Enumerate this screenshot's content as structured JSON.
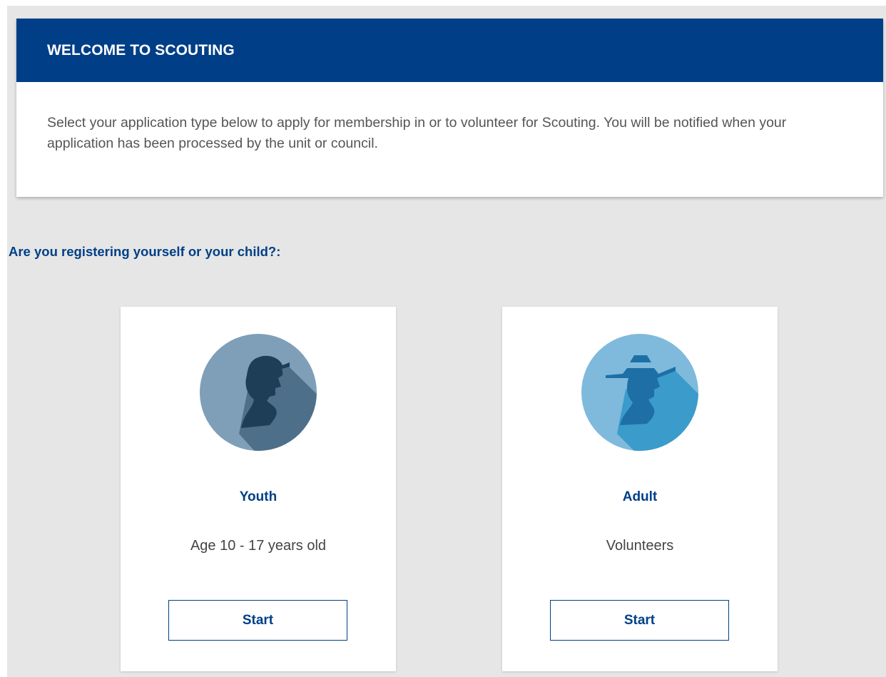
{
  "welcome": {
    "title": "WELCOME TO SCOUTING",
    "body": "Select your application type below to apply for membership in or to volunteer for Scouting. You will be notified when your application has been processed by the unit or council."
  },
  "question": "Are you registering yourself or your child?:",
  "options": [
    {
      "title": "Youth",
      "description": "Age 10 - 17 years old",
      "button_label": "Start",
      "icon": "youth-avatar-icon",
      "color": "#7f9fb9"
    },
    {
      "title": "Adult",
      "description": "Volunteers",
      "button_label": "Start",
      "icon": "adult-avatar-icon",
      "color": "#7fbadc"
    }
  ],
  "colors": {
    "primary": "#003f87",
    "background": "#e6e6e6",
    "body_text": "#555555"
  }
}
